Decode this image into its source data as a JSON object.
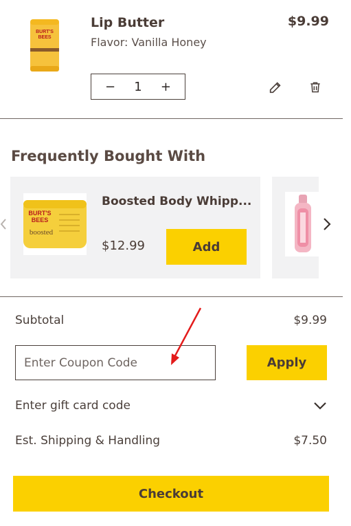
{
  "cart_item": {
    "title": "Lip Butter",
    "flavor": "Flavor: Vanilla Honey",
    "price": "$9.99",
    "quantity": "1",
    "minus": "−",
    "plus": "+",
    "image_icon": "lip-butter-tube",
    "icons": {
      "edit": "pencil-icon",
      "delete": "trash-icon"
    }
  },
  "frequently_bought": {
    "heading": "Frequently Bought With",
    "items": [
      {
        "title": "Boosted Body Whipp...",
        "price": "$12.99",
        "button": "Add",
        "image_icon": "boosted-jar"
      },
      {
        "image_icon": "lip-gloss-tube"
      }
    ]
  },
  "summary": {
    "subtotal_label": "Subtotal",
    "subtotal_value": "$9.99",
    "coupon_placeholder": "Enter Coupon Code",
    "apply_label": "Apply",
    "gift_card_label": "Enter gift card code",
    "shipping_label": "Est. Shipping & Handling",
    "shipping_value": "$7.50",
    "checkout_label": "Checkout"
  },
  "colors": {
    "accent_yellow": "#fbd000",
    "text_brown": "#4a3c36",
    "annotation_red": "#e31b1b"
  }
}
